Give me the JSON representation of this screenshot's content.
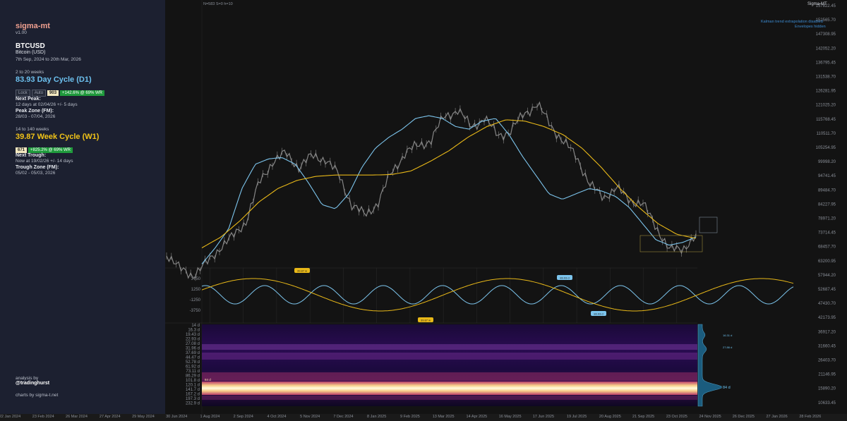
{
  "sidebar": {
    "app_name": "sigma-mt",
    "version": "v1.00",
    "symbol": "BTCUSD",
    "symbol_name": "Bitcoin (USD)",
    "date_range": "7th Sep, 2024 to 20th Mar, 2026",
    "cycle1": {
      "range": "2 to 20 weeks",
      "title": "83.93 Day Cycle (D1)",
      "lock_label": "Lock",
      "auto_label": "Auto",
      "strength": "903",
      "performance": "+142.6% @ 69% WR"
    },
    "next_peak": {
      "label": "Next Peak:",
      "value": "12 days at 02/04/26 +/- 5 days",
      "zone_label": "Peak Zone (FM):",
      "zone_value": "28/03 - 07/04, 2026"
    },
    "cycle2": {
      "range": "14 to 140 weeks",
      "title": "39.87 Week Cycle (W1)",
      "strength": "671",
      "performance": "+825.2% @ 69% WR"
    },
    "next_trough": {
      "label": "Next Trough:",
      "value": "Now at 19/02/26 +/- 14 days",
      "zone_label": "Trough Zone (FM):",
      "zone_value": "05/02 - 05/03, 2026"
    },
    "analysis_by": "analysis by",
    "handle": "@tradinghurst",
    "charts_by": "charts by sigma-t.net"
  },
  "chart_header": "N=583  S=0  h=10",
  "chart_brand": "Sigma-MT",
  "notes": [
    "Kalman trend extrapolation disabled",
    "Envelopes hidden"
  ],
  "colors": {
    "price": "#9a9a9a",
    "fast_cycle": "#7cc4ec",
    "slow_cycle": "#e8b818",
    "background": "#131313",
    "sidebar": "#1c2030"
  },
  "chart_data": {
    "type": "line",
    "price_axis": [
      "157822.45",
      "152565.70",
      "147308.95",
      "142052.20",
      "136795.45",
      "131538.70",
      "126281.95",
      "121025.20",
      "115768.45",
      "110511.70",
      "105254.95",
      "99998.20",
      "94741.45",
      "89484.70",
      "84227.95",
      "78971.20",
      "73714.45",
      "68457.70",
      "63200.95",
      "57944.20",
      "52687.45",
      "47430.70",
      "42173.95",
      "36917.20",
      "31660.45",
      "26403.70",
      "21146.95",
      "15890.20",
      "10633.45"
    ],
    "x_tick_labels": [
      "22 Jan 2024",
      "23 Feb 2024",
      "26 Mar 2024",
      "27 Apr 2024",
      "29 May 2024",
      "30 Jun 2024",
      "1 Aug 2024",
      "2 Sep 2024",
      "4 Oct 2024",
      "5 Nov 2024",
      "7 Dec 2024",
      "8 Jan 2025",
      "9 Feb 2025",
      "13 Mar 2025",
      "14 Apr 2025",
      "16 May 2025",
      "17 Jun 2025",
      "19 Jul 2025",
      "20 Aug 2025",
      "21 Sep 2025",
      "23 Oct 2025",
      "24 Nov 2025",
      "26 Dec 2025",
      "27 Jan 2026",
      "28 Feb 2026"
    ],
    "series": [
      {
        "name": "BTCUSD",
        "values": [
          66000,
          60000,
          58000,
          62000,
          68000,
          72000,
          78000,
          92000,
          100000,
          103000,
          98000,
          102000,
          101000,
          95000,
          84000,
          80000,
          85000,
          96000,
          103000,
          106000,
          108000,
          117000,
          119000,
          113000,
          116000,
          110000,
          111000,
          118000,
          121000,
          114000,
          107000,
          102000,
          91000,
          87000,
          90000,
          86000,
          84000,
          76000,
          67000,
          68000,
          72000
        ]
      },
      {
        "name": "83.93 Day Cycle (D1)",
        "values": [
          62000,
          68000,
          75000,
          90000,
          99000,
          101000,
          101500,
          99000,
          92000,
          84000,
          82500,
          88000,
          98000,
          105000,
          109000,
          112000,
          116000,
          117000,
          116000,
          113000,
          112000,
          115000,
          116000,
          110000,
          102000,
          95000,
          88000,
          86000,
          88000,
          90000,
          89000,
          87000,
          83000,
          77000,
          71000,
          69000,
          70000,
          72000
        ]
      },
      {
        "name": "39.87 Week Cycle (W1)",
        "values": [
          68000,
          72000,
          78000,
          85000,
          90000,
          93000,
          94500,
          95000,
          95000,
          95000,
          95200,
          96500,
          100000,
          104000,
          109000,
          113000,
          115500,
          115000,
          113000,
          110000,
          105000,
          98000,
          90000,
          83000,
          77000,
          73000,
          71500
        ]
      }
    ],
    "cycle_oscillator": {
      "y_ticks": [
        "3750",
        "1250",
        "-1250",
        "-3750"
      ],
      "fast_labels": [
        "83.93 d",
        "83.93 d"
      ],
      "slow_labels": [
        "39.87 w",
        "39.87 w"
      ]
    },
    "spectrogram": {
      "y_ticks": [
        "14 d",
        "16.3 d",
        "19.43 d",
        "22.93 d",
        "27.08 d",
        "31.96 d",
        "37.69 d",
        "44.47 d",
        "52.78 d",
        "61.92 d",
        "73.11 d",
        "86.29 d",
        "101.8 d",
        "120.1 d",
        "141.7 d",
        "167.2 d",
        "197.3 d",
        "232.9 d"
      ],
      "peak_labels": [
        "16.31 d",
        "27.86 d",
        "84 d"
      ],
      "dominant_label": "84 d"
    }
  }
}
